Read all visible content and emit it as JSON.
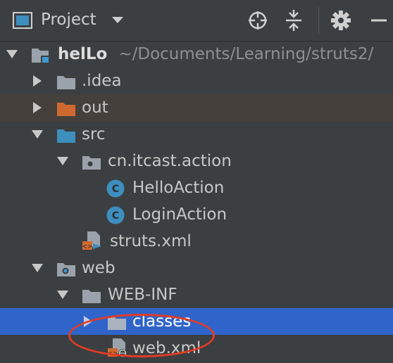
{
  "header": {
    "title": "Project",
    "icons": [
      "project-icon",
      "caret-down-icon",
      "locate-icon",
      "collapse-all-icon",
      "gear-icon",
      "hide-icon"
    ]
  },
  "tree": [
    {
      "label": "helLo",
      "path": "~/Documents/Learning/struts2/",
      "icon": "module-icon",
      "expanded": true
    },
    {
      "label": ".idea",
      "icon": "folder-icon",
      "expanded": false
    },
    {
      "label": "out",
      "icon": "excluded-folder-icon",
      "expanded": false
    },
    {
      "label": "src",
      "icon": "source-folder-icon",
      "expanded": true
    },
    {
      "label": "cn.itcast.action",
      "icon": "package-icon",
      "expanded": true
    },
    {
      "label": "HelloAction",
      "icon": "class-icon"
    },
    {
      "label": "LoginAction",
      "icon": "class-icon"
    },
    {
      "label": "struts.xml",
      "icon": "struts-xml-icon"
    },
    {
      "label": "web",
      "icon": "web-folder-icon",
      "expanded": true
    },
    {
      "label": "WEB-INF",
      "icon": "folder-icon",
      "expanded": true
    },
    {
      "label": "classes",
      "icon": "folder-icon",
      "expanded": false,
      "selected": true
    },
    {
      "label": "web.xml",
      "icon": "web-xml-icon"
    }
  ],
  "colors": {
    "background": "#3c3f41",
    "selection": "#2f65ca",
    "annotation_circle": "#e23b24",
    "excluded_folder": "#d0692f",
    "source_folder": "#3d8fbd"
  }
}
